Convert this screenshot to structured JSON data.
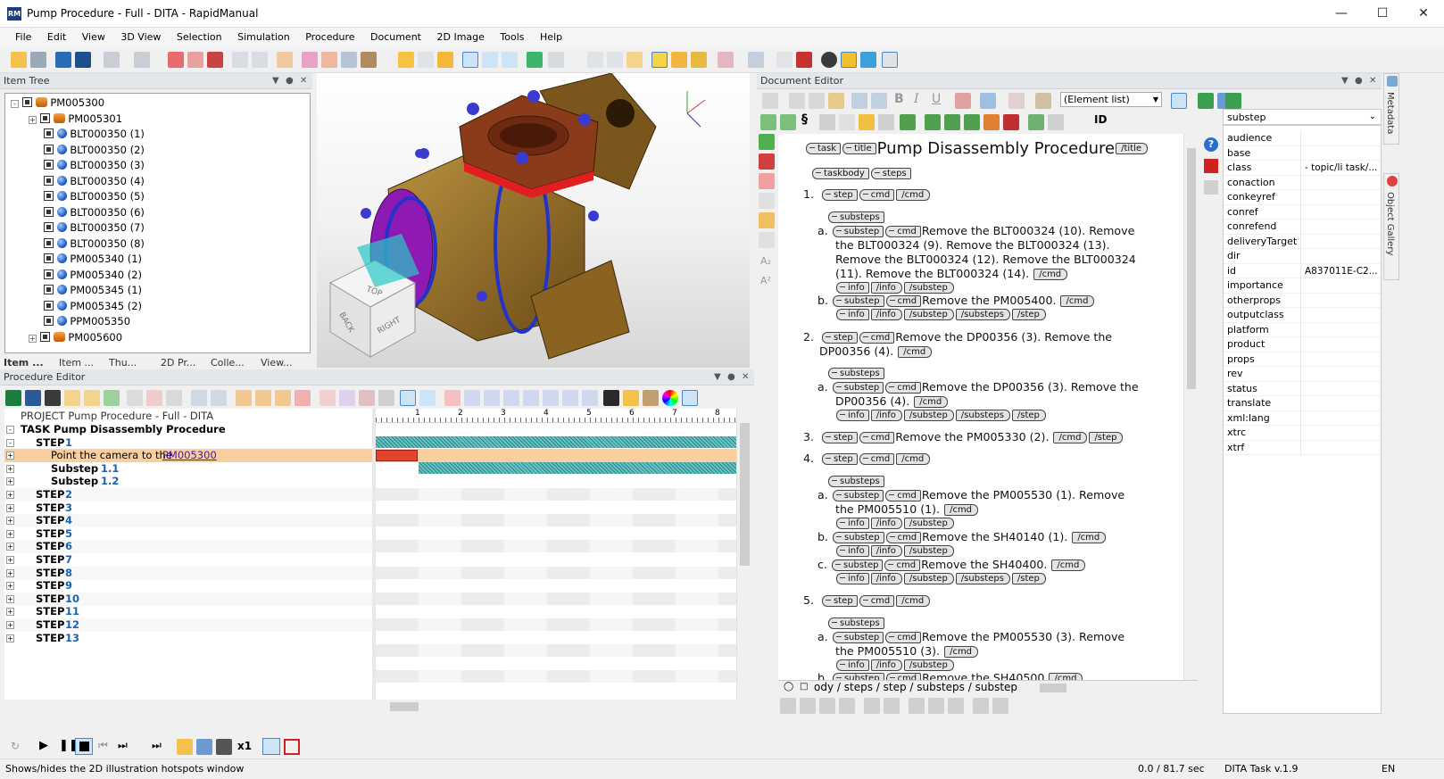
{
  "window": {
    "title": "Pump Procedure - Full - DITA - RapidManual",
    "app_icon_text": "RM"
  },
  "menu": [
    "File",
    "Edit",
    "View",
    "3D View",
    "Selection",
    "Simulation",
    "Procedure",
    "Document",
    "2D Image",
    "Tools",
    "Help"
  ],
  "item_tree": {
    "title": "Item Tree",
    "items": [
      {
        "label": "PM005300",
        "level": 0,
        "icon": "assembly-icon",
        "expander": "-"
      },
      {
        "label": "PM005301",
        "level": 1,
        "icon": "assembly-icon",
        "expander": "+"
      },
      {
        "label": "BLT000350 (1)",
        "level": 1,
        "icon": "part-icon"
      },
      {
        "label": "BLT000350 (2)",
        "level": 1,
        "icon": "part-icon"
      },
      {
        "label": "BLT000350 (3)",
        "level": 1,
        "icon": "part-icon"
      },
      {
        "label": "BLT000350 (4)",
        "level": 1,
        "icon": "part-icon"
      },
      {
        "label": "BLT000350 (5)",
        "level": 1,
        "icon": "part-icon"
      },
      {
        "label": "BLT000350 (6)",
        "level": 1,
        "icon": "part-icon"
      },
      {
        "label": "BLT000350 (7)",
        "level": 1,
        "icon": "part-icon"
      },
      {
        "label": "BLT000350 (8)",
        "level": 1,
        "icon": "part-icon"
      },
      {
        "label": "PM005340 (1)",
        "level": 1,
        "icon": "part-icon"
      },
      {
        "label": "PM005340 (2)",
        "level": 1,
        "icon": "part-icon"
      },
      {
        "label": "PM005345 (1)",
        "level": 1,
        "icon": "part-icon"
      },
      {
        "label": "PM005345 (2)",
        "level": 1,
        "icon": "part-icon"
      },
      {
        "label": "PPM005350",
        "level": 1,
        "icon": "part-icon"
      },
      {
        "label": "PM005600",
        "level": 1,
        "icon": "assembly-icon",
        "expander": "+"
      }
    ],
    "tabs": [
      "Item ...",
      "Item ...",
      "Thu...",
      "2D Pr...",
      "Colle...",
      "View..."
    ]
  },
  "view3d": {
    "cube_labels": {
      "top": "TOP",
      "right": "RIGHT",
      "back": "BACK"
    }
  },
  "procedure_editor": {
    "title": "Procedure Editor",
    "project_row": "PROJECT Pump Procedure - Full - DITA",
    "task_row": "TASK Pump Disassembly Procedure",
    "step1": {
      "label": "STEP",
      "num": "1"
    },
    "action_row": {
      "text": "Point the camera to the ",
      "link": "PM005300"
    },
    "substeps": [
      {
        "label": "Substep",
        "num": "1.1"
      },
      {
        "label": "Substep",
        "num": "1.2"
      }
    ],
    "steps": [
      "2",
      "3",
      "4",
      "5",
      "6",
      "7",
      "8",
      "9",
      "10",
      "11",
      "12",
      "13"
    ],
    "step_word": "STEP",
    "ruler": [
      "1",
      "2",
      "3",
      "4",
      "5",
      "6",
      "7",
      "8"
    ]
  },
  "document_editor": {
    "title": "Document Editor",
    "element_list": "(Element list)",
    "id_label": "ID",
    "doc_title": "Pump Disassembly Procedure",
    "tags": {
      "task": "task",
      "title": "title",
      "etitle": "/title",
      "taskbody": "taskbody",
      "steps": "steps",
      "step": "step",
      "cmd": "cmd",
      "ecmd": "/cmd",
      "substeps": "substeps",
      "substep": "substep",
      "info": "info",
      "einfo": "/info",
      "esubstep": "/substep",
      "esubsteps": "/substeps",
      "estep": "/step"
    },
    "numbers": [
      "1.",
      "2.",
      "3.",
      "4.",
      "5."
    ],
    "letters": [
      "a.",
      "b.",
      "c."
    ],
    "text": {
      "s1a_1": "Remove the BLT000324 (10). Remove",
      "s1a_2": "the BLT000324 (9). Remove the BLT000324 (13).",
      "s1a_3": "Remove the BLT000324 (12). Remove the BLT000324",
      "s1a_4": "(11). Remove the BLT000324 (14).",
      "s1b": "Remove the PM005400.",
      "s2_1": "Remove the DP00356 (3). Remove the",
      "s2_2": "DP00356 (4).",
      "s2a_1": "Remove the DP00356 (3). Remove the",
      "s2a_2": "DP00356 (4).",
      "s3": "Remove the PM005330 (2).",
      "s4a_1": "Remove the PM005530 (1). Remove",
      "s4a_2": "the PM005510 (1).",
      "s4b": "Remove the SH40140 (1).",
      "s4c": "Remove the SH40400.",
      "s5a_1": "Remove the PM005530 (3). Remove",
      "s5a_2": "the PM005510 (3).",
      "s5b": "Remove the SH40500"
    },
    "breadcrumb": "ody / steps / step / substeps / substep"
  },
  "properties": {
    "selected": "substep",
    "rows": [
      {
        "name": "audience",
        "value": ""
      },
      {
        "name": "base",
        "value": ""
      },
      {
        "name": "class",
        "value": "- topic/li task/..."
      },
      {
        "name": "conaction",
        "value": ""
      },
      {
        "name": "conkeyref",
        "value": ""
      },
      {
        "name": "conref",
        "value": ""
      },
      {
        "name": "conrefend",
        "value": ""
      },
      {
        "name": "deliveryTarget",
        "value": ""
      },
      {
        "name": "dir",
        "value": ""
      },
      {
        "name": "id",
        "value": "A837011E-C2..."
      },
      {
        "name": "importance",
        "value": ""
      },
      {
        "name": "otherprops",
        "value": ""
      },
      {
        "name": "outputclass",
        "value": ""
      },
      {
        "name": "platform",
        "value": ""
      },
      {
        "name": "product",
        "value": ""
      },
      {
        "name": "props",
        "value": ""
      },
      {
        "name": "rev",
        "value": ""
      },
      {
        "name": "status",
        "value": ""
      },
      {
        "name": "translate",
        "value": ""
      },
      {
        "name": "xml:lang",
        "value": ""
      },
      {
        "name": "xtrc",
        "value": ""
      },
      {
        "name": "xtrf",
        "value": ""
      }
    ]
  },
  "side_tabs": [
    "Metadata",
    "Object Gallery"
  ],
  "status": {
    "hint": "Shows/hides the 2D illustration hotspots window",
    "time": "0.0 / 81.7 sec",
    "doctype": "DITA Task v.1.9",
    "lang": "EN"
  },
  "player": {
    "speed": "x1"
  },
  "colors": {
    "accent": "#0b5cad",
    "task_highlight": "#f9cfa0",
    "gantt_red": "#e0442e",
    "teal": "#2a9a9a"
  }
}
